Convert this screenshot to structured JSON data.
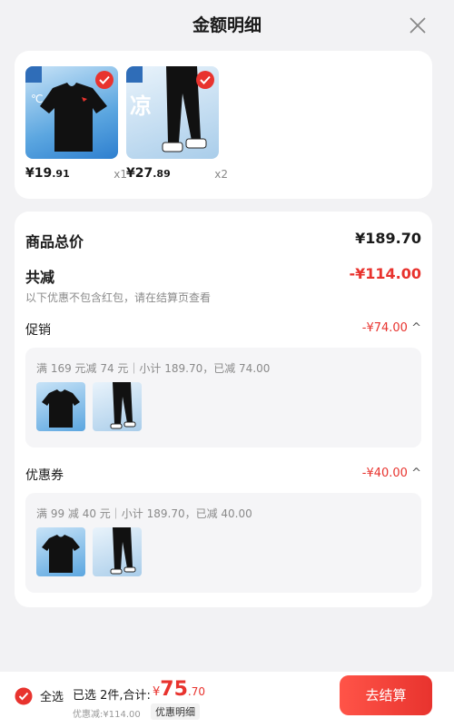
{
  "header": {
    "title": "金额明细"
  },
  "products": [
    {
      "price_main": "¥19",
      "price_dec": ".91",
      "qty": "x1",
      "thumb_text": "℃"
    },
    {
      "price_main": "¥27",
      "price_dec": ".89",
      "qty": "x2",
      "thumb_text": "凉"
    }
  ],
  "summary": {
    "total_label": "商品总价",
    "total_value": "¥189.70",
    "discount_label": "共减",
    "discount_value": "-¥114.00",
    "note": "以下优惠不包含红包，请在结算页查看",
    "promo": {
      "label": "促销",
      "value": "-¥74.00",
      "chevron": "^",
      "detail": "满 169 元减 74 元｜小计 189.70，已减 74.00"
    },
    "coupon": {
      "label": "优惠券",
      "value": "-¥40.00",
      "chevron": "^",
      "detail": "满 99 减 40 元｜小计 189.70，已减 40.00"
    }
  },
  "bottom": {
    "select_all": "全选",
    "selected_text": "已选 2件,合计:",
    "total_symbol": "¥",
    "total_int": "75",
    "total_dec": ".70",
    "discount_note": "优惠减:¥114.00",
    "detail_link": "优惠明细",
    "checkout": "去结算"
  },
  "colors": {
    "accent": "#e8332e",
    "background": "#f2f2f4"
  }
}
